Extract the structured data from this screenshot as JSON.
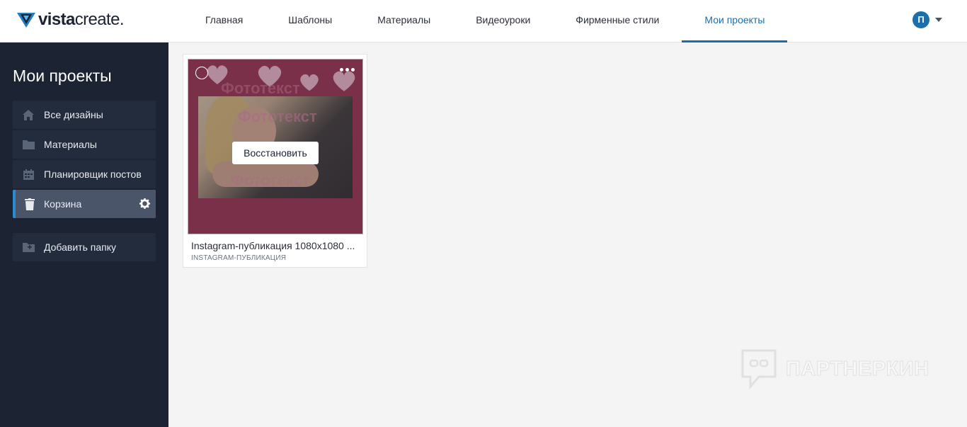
{
  "app": {
    "logo_bold": "vista",
    "logo_regular": "create."
  },
  "nav": {
    "items": [
      {
        "label": "Главная"
      },
      {
        "label": "Шаблоны"
      },
      {
        "label": "Материалы"
      },
      {
        "label": "Видеоуроки"
      },
      {
        "label": "Фирменные стили"
      },
      {
        "label": "Мои проекты",
        "active": true
      }
    ],
    "avatar_initial": "П"
  },
  "sidebar": {
    "title": "Мои проекты",
    "items": [
      {
        "label": "Все дизайны",
        "icon": "home-icon"
      },
      {
        "label": "Материалы",
        "icon": "folder-icon"
      },
      {
        "label": "Планировщик постов",
        "icon": "calendar-icon"
      },
      {
        "label": "Корзина",
        "icon": "trash-icon",
        "active": true,
        "settings_icon": "gear-icon"
      },
      {
        "label": "Добавить папку",
        "icon": "add-folder-icon"
      }
    ]
  },
  "main": {
    "cards": [
      {
        "title": "Instagram-публикация 1080x1080 ...",
        "type": "INSTAGRAM-ПУБЛИКАЦИЯ",
        "restore_label": "Восстановить",
        "thumb_text": "Фототекст"
      }
    ]
  },
  "watermark": {
    "text": "ПАРТНЕРКИН"
  },
  "colors": {
    "accent": "#1b6fa8",
    "sidebar_bg": "#1c2333",
    "sidebar_item_bg": "#232c3d",
    "sidebar_active_bg": "#4a556a",
    "thumb_bg": "#9c2a4a"
  }
}
